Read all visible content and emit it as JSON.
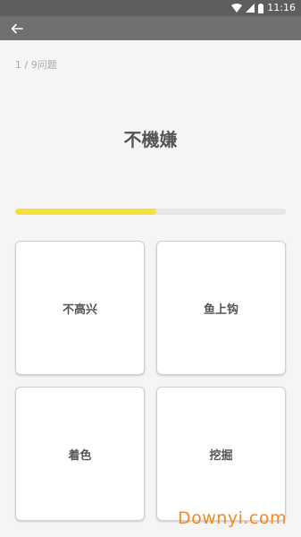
{
  "status_bar": {
    "time": "11:16",
    "icons": [
      "wifi-icon",
      "signal-icon",
      "battery-icon"
    ]
  },
  "app_bar": {
    "back_icon": "arrow-left-icon"
  },
  "quiz": {
    "progress_text": "1 / 9问题",
    "question": "不機嫌",
    "progress_fraction": 0.52,
    "options": [
      "不高兴",
      "鱼上钩",
      "着色",
      "挖掘"
    ]
  },
  "colors": {
    "accent": "#f5e03c",
    "app_bar": "#707070",
    "status_bar": "#5e5e5e"
  },
  "watermark": "Downyi.com"
}
